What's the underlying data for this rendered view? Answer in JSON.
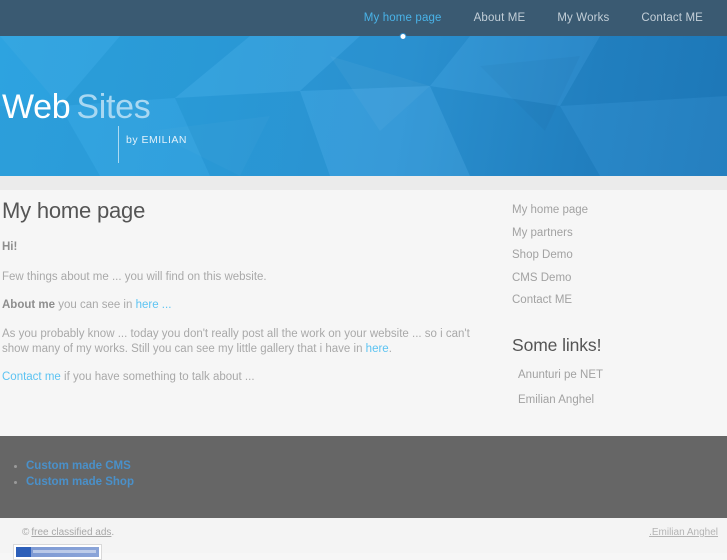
{
  "topnav": {
    "items": [
      {
        "label": "My home page",
        "active": true
      },
      {
        "label": "About ME",
        "active": false
      },
      {
        "label": "My Works",
        "active": false
      },
      {
        "label": "Contact ME",
        "active": false
      }
    ]
  },
  "hero": {
    "title_strong": "Web",
    "title_light": "Sites",
    "subtitle": "by EMILIAN"
  },
  "content": {
    "page_title": "My home page",
    "greeting": "Hi!",
    "para_intro": "Few things about me ... you will find on this website.",
    "para_about_bold": "About me",
    "para_about_text": " you can see in ",
    "para_about_link": "here ...",
    "para_works_1": "As you probably know ... today you don't really post all the work on your website ... so i can't show many of my works. Still you can see my little gallery that i have in ",
    "para_works_link": "here",
    "para_works_2": ".",
    "para_contact_link": "Contact me",
    "para_contact_text": " if you have something to talk about ..."
  },
  "sidebar": {
    "menu": [
      {
        "label": "My home page"
      },
      {
        "label": "My partners"
      },
      {
        "label": "Shop Demo"
      },
      {
        "label": "CMS Demo"
      },
      {
        "label": "Contact ME"
      }
    ],
    "links_heading": "Some links!",
    "links": [
      {
        "label": "Anunturi pe NET"
      },
      {
        "label": "Emilian Anghel"
      }
    ]
  },
  "footer": {
    "items": [
      {
        "label": "Custom made CMS"
      },
      {
        "label": "Custom made Shop"
      }
    ],
    "copyright_symbol": "©",
    "copyright_link": "free classified ads",
    "copyright_suffix": ".",
    "credit": ".Emilian Anghel"
  },
  "colors": {
    "topbar": "#3a5a72",
    "hero_from": "#2da3e0",
    "hero_to": "#1f7cbe",
    "accent_link": "#5cc3f2",
    "nav_active": "#49b3e8",
    "footer_dark": "#666666",
    "footer_link": "#4a90c9",
    "strip": "#ebebeb",
    "page_bg": "#f6f6f6"
  }
}
